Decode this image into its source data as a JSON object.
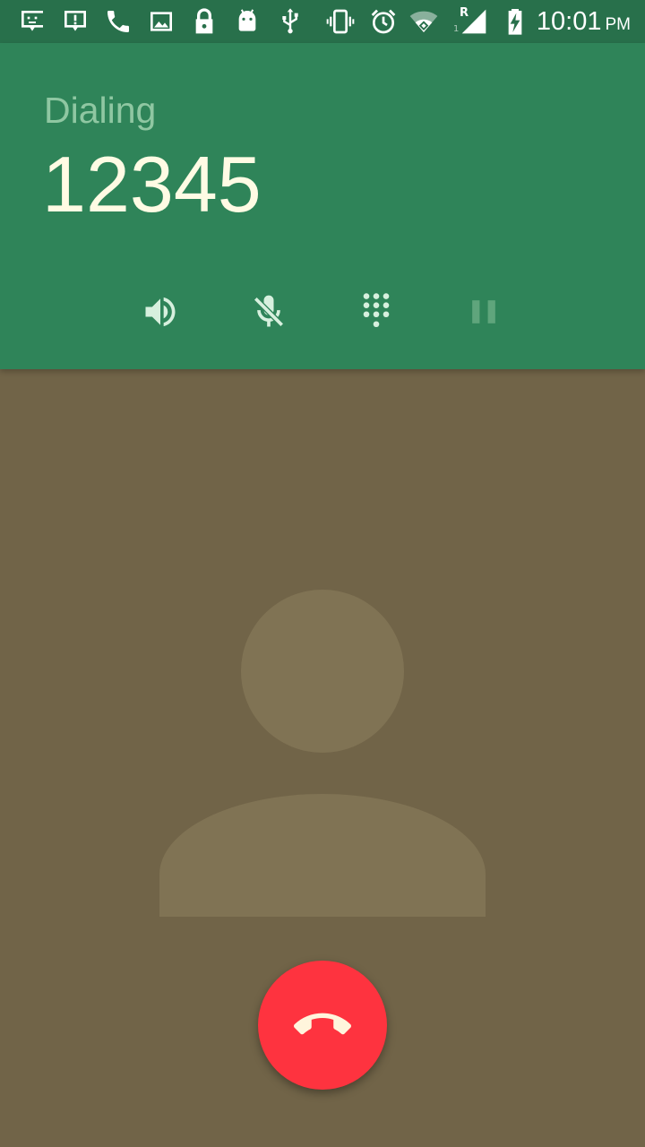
{
  "status_bar": {
    "icons": [
      "feedback-icon",
      "alert-message-icon",
      "phone-call-icon",
      "image-icon",
      "lock-icon",
      "android-icon",
      "usb-icon",
      "vibrate-icon",
      "alarm-icon",
      "wifi-icon",
      "signal-icon",
      "battery-charging-icon"
    ],
    "sim_letter": "R",
    "sim_number": "1",
    "time": "10:01",
    "ampm": "PM"
  },
  "call": {
    "state": "Dialing",
    "number": "12345",
    "buttons": [
      {
        "name": "speaker",
        "icon": "speaker-icon"
      },
      {
        "name": "mute",
        "icon": "mic-off-icon"
      },
      {
        "name": "dialpad",
        "icon": "dialpad-icon"
      },
      {
        "name": "hold",
        "icon": "pause-icon"
      }
    ]
  },
  "end_call": {
    "icon": "call-end-icon"
  },
  "colors": {
    "status_bar": "#28704b",
    "header": "#2f8459",
    "background": "#716448",
    "photo_placeholder": "#807354",
    "end_call": "#fe333f",
    "number_text": "#fffbe4",
    "state_text": "#8fc7a2"
  }
}
